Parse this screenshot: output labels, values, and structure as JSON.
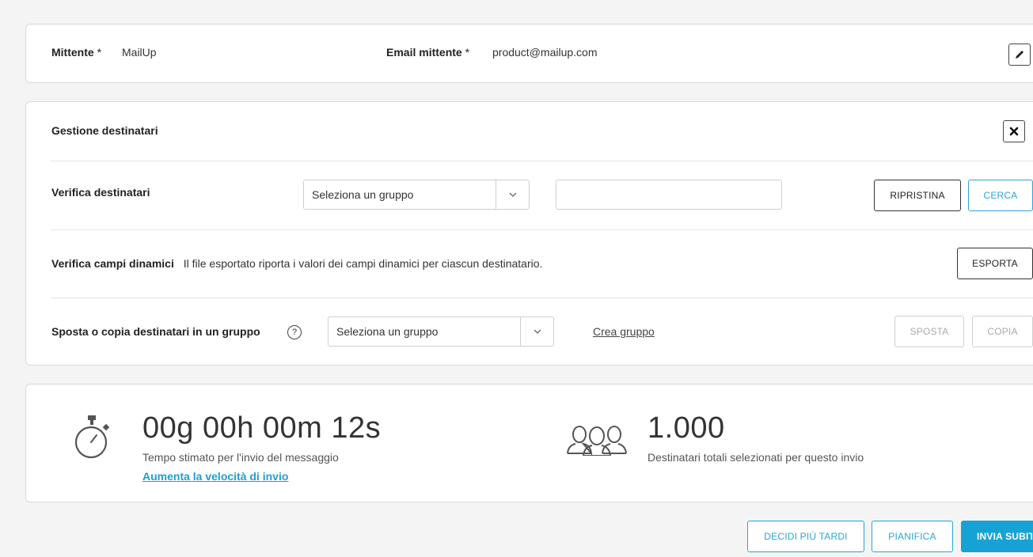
{
  "sender": {
    "sender_label": "Mittente",
    "required_mark": "*",
    "sender_value": "MailUp",
    "email_label": "Email mittente",
    "email_value": "product@mailup.com",
    "edit_icon": "pencil-icon"
  },
  "recipients": {
    "title": "Gestione destinatari",
    "close_icon": "close-icon",
    "verify": {
      "label": "Verifica destinatari",
      "select_value": "Seleziona un gruppo",
      "search_value": "",
      "reset_label": "RIPRISTINA",
      "search_label": "CERCA"
    },
    "dynamic": {
      "label": "Verifica campi dinamici",
      "description": "Il file esportato riporta i valori dei campi dinamici per ciascun destinatario.",
      "export_label": "ESPORTA"
    },
    "move": {
      "label": "Sposta o copia destinatari in un gruppo",
      "help": "?",
      "select_value": "Seleziona un gruppo",
      "create_link": "Crea gruppo",
      "move_label": "SPOSTA",
      "copy_label": "COPIA"
    }
  },
  "stats": {
    "time_value": "00g 00h 00m 12s",
    "time_caption": "Tempo stimato per l'invio del messaggio",
    "speed_link": "Aumenta la velocità di invio",
    "recipients_value": "1.000",
    "recipients_caption": "Destinatari totali selezionati per questo invio",
    "timer_icon": "stopwatch-icon",
    "people_icon": "group-icon"
  },
  "actions": {
    "later_label": "DECIDI PIÙ TARDI",
    "schedule_label": "PIANIFICA",
    "send_label": "INVIA SUBITO"
  },
  "colors": {
    "accent": "#17a2d6",
    "border": "#d9d9d9"
  }
}
